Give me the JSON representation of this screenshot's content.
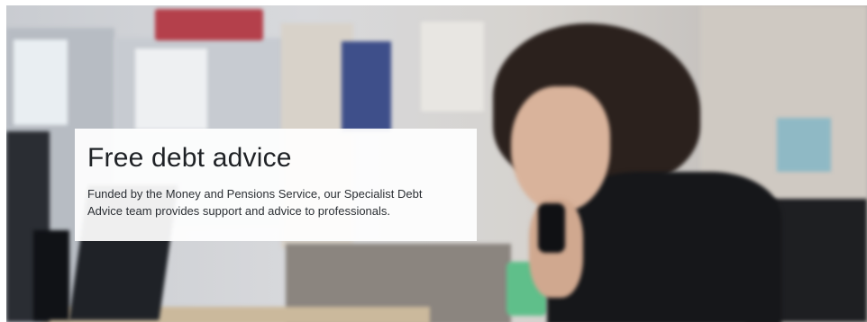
{
  "hero": {
    "image_alt": "Woman at an office desk talking on the phone",
    "title": "Free debt advice",
    "description": "Funded by the Money and Pensions Service, our Specialist Debt Advice team provides support and advice to professionals."
  },
  "colors": {
    "card_background": "#ffffff",
    "title_text": "#1f2226",
    "body_text": "#2b2f34"
  }
}
